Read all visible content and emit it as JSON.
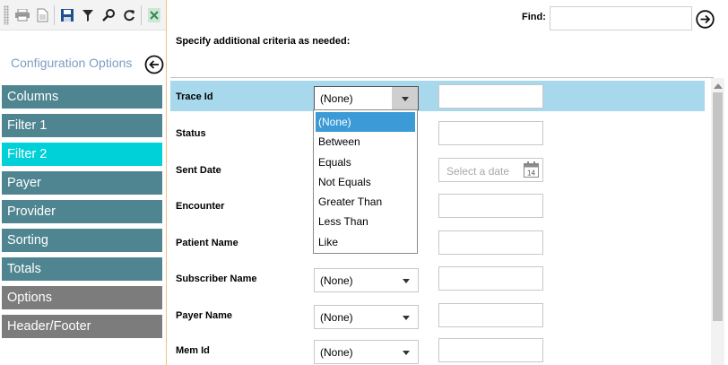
{
  "toolbar": {
    "buttons": [
      {
        "icon": "printer-icon"
      },
      {
        "icon": "document-icon"
      },
      {
        "icon": "save-icon"
      },
      {
        "icon": "filter-icon"
      },
      {
        "icon": "search-icon"
      },
      {
        "icon": "refresh-icon"
      },
      {
        "icon": "excel-icon"
      }
    ]
  },
  "sidebar": {
    "title": "Configuration Options",
    "items": [
      {
        "label": "Columns"
      },
      {
        "label": "Filter 1"
      },
      {
        "label": "Filter 2",
        "active": true
      },
      {
        "label": "Payer"
      },
      {
        "label": "Provider"
      },
      {
        "label": "Sorting"
      },
      {
        "label": "Totals"
      },
      {
        "label": "Options"
      },
      {
        "label": "Header/Footer"
      }
    ]
  },
  "main": {
    "find_label": "Find:",
    "find_value": "",
    "subtitle": "Specify additional criteria as needed:",
    "rows": [
      {
        "label": "Trace Id",
        "operator": "(None)",
        "value": ""
      },
      {
        "label": "Status",
        "operator": "",
        "value": ""
      },
      {
        "label": "Sent Date",
        "operator": "",
        "date_placeholder": "Select a date",
        "calendar_day": "14"
      },
      {
        "label": "Encounter",
        "operator": "",
        "value": ""
      },
      {
        "label": "Patient Name",
        "operator": "",
        "value": ""
      },
      {
        "label": "Subscriber Name",
        "operator": "(None)",
        "value": ""
      },
      {
        "label": "Payer Name",
        "operator": "(None)",
        "value": ""
      },
      {
        "label": "Mem Id",
        "operator": "(None)",
        "value": ""
      }
    ],
    "dropdown_options": [
      "(None)",
      "Between",
      "Equals",
      "Not Equals",
      "Greater Than",
      "Less Than",
      "Like"
    ],
    "dropdown_selected": "(None)"
  },
  "colors": {
    "nav": "#4f8590",
    "nav_active": "#00d0d8",
    "nav_gray": "#7c7c7c",
    "selected_row": "#a8d8ec",
    "highlight": "#3c9bd6"
  }
}
